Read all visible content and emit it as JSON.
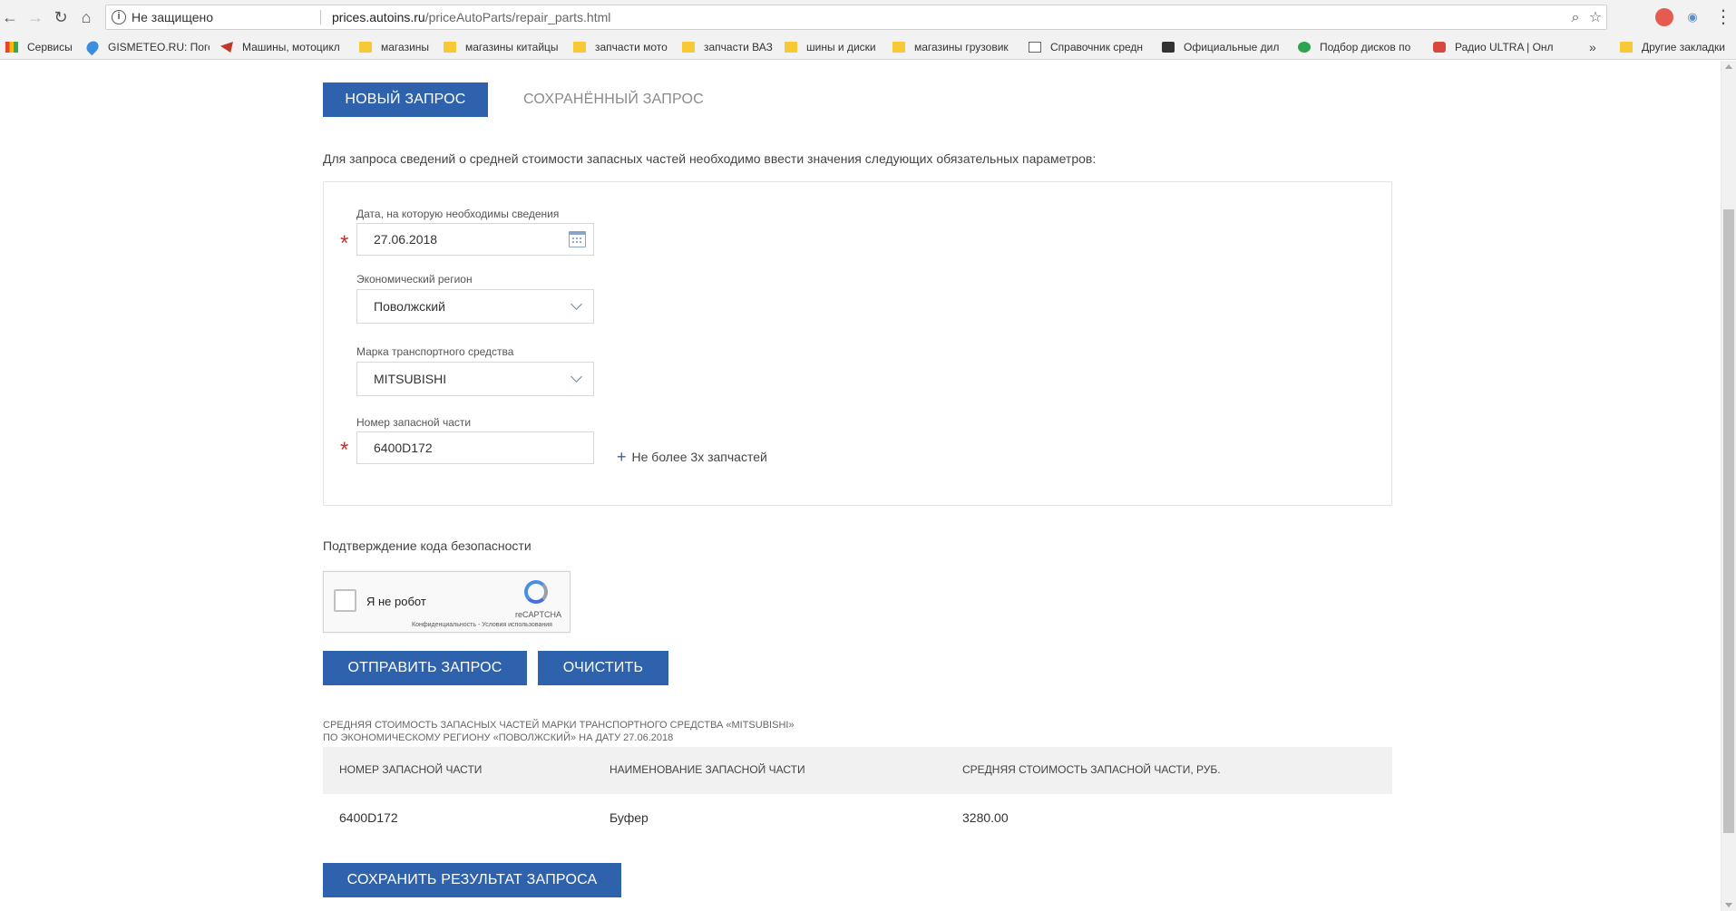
{
  "browser": {
    "security_label": "Не защищено",
    "url_host": "prices.autoins.ru",
    "url_path": "/priceAutoParts/repair_parts.html",
    "bookmarks": [
      {
        "label": "Сервисы"
      },
      {
        "label": "GISMETEO.RU: Пого"
      },
      {
        "label": "Машины, мотоцикл"
      },
      {
        "label": "магазины"
      },
      {
        "label": "магазины китайцы"
      },
      {
        "label": "запчасти мото"
      },
      {
        "label": "запчасти ВАЗ"
      },
      {
        "label": "шины и диски"
      },
      {
        "label": "магазины грузовик"
      },
      {
        "label": "Справочник средн"
      },
      {
        "label": "Официальные дил"
      },
      {
        "label": "Подбор дисков по"
      },
      {
        "label": "Радио ULTRA | Онл"
      }
    ],
    "more_bookmarks": "»",
    "other_bookmarks": "Другие закладки"
  },
  "tabs": {
    "new_request": "Новый запрос",
    "saved_request": "Сохранённый запрос"
  },
  "intro_text": "Для запроса сведений о средней стоимости запасных частей необходимо ввести значения следующих обязательных параметров:",
  "form": {
    "date_label": "Дата, на которую необходимы сведения",
    "date_value": "27.06.2018",
    "region_label": "Экономический регион",
    "region_value": "Поволжский",
    "brand_label": "Марка транспортного средства",
    "brand_value": "MITSUBISHI",
    "part_label": "Номер запасной части",
    "part_value": "6400D172",
    "add_part_label": "Не более 3х запчастей",
    "required_mark": "*"
  },
  "captcha": {
    "section_title": "Подтверждение кода безопасности",
    "checkbox_label": "Я не робот",
    "brand": "reCAPTCHA",
    "terms": "Конфиденциальность - Условия использования"
  },
  "buttons": {
    "submit": "Отправить запрос",
    "clear": "Очистить",
    "save_result": "Сохранить результат запроса"
  },
  "result": {
    "caption_line1": "Средняя стоимость запасных частей марки транспортного средства «MITSUBISHI»",
    "caption_line2": "по экономическому региону «Поволжский» на дату 27.06.2018",
    "columns": [
      "Номер запасной части",
      "Наименование запасной части",
      "Средняя стоимость запасной части, руб."
    ],
    "rows": [
      [
        "6400D172",
        "Буфер",
        "3280.00"
      ]
    ]
  },
  "colors": {
    "primary": "#2f62ac",
    "required": "#d12b2b"
  }
}
